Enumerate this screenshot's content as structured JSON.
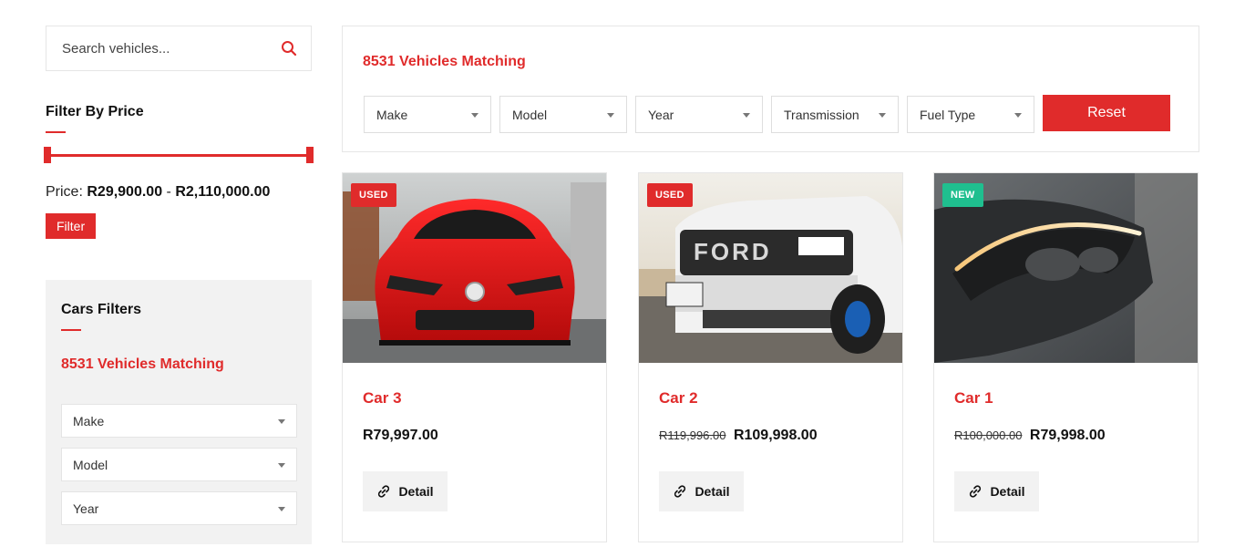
{
  "search": {
    "placeholder": "Search vehicles..."
  },
  "price_filter": {
    "title": "Filter By Price",
    "price_label": "Price:",
    "min": "R29,900.00",
    "separator": "-",
    "max": "R2,110,000.00",
    "button": "Filter"
  },
  "cars_filters": {
    "title": "Cars Filters",
    "matching": "8531 Vehicles Matching",
    "selects": [
      "Make",
      "Model",
      "Year"
    ]
  },
  "topbar": {
    "matching": "8531 Vehicles Matching",
    "selects": [
      "Make",
      "Model",
      "Year",
      "Transmission",
      "Fuel Type"
    ],
    "reset": "Reset"
  },
  "cards": [
    {
      "badge": "USED",
      "name": "Car 3",
      "old_price": "",
      "price": "R79,997.00",
      "detail": "Detail"
    },
    {
      "badge": "USED",
      "name": "Car 2",
      "old_price": "R119,996.00",
      "price": "R109,998.00",
      "detail": "Detail"
    },
    {
      "badge": "NEW",
      "name": "Car 1",
      "old_price": "R100,000.00",
      "price": "R79,998.00",
      "detail": "Detail"
    }
  ],
  "colors": {
    "accent": "#e02b2b",
    "new_badge": "#1fbf8f",
    "panel_bg": "#f2f2f2"
  },
  "icons": {
    "search": "search-icon",
    "detail": "link-icon",
    "select": "chevron-down-icon"
  }
}
